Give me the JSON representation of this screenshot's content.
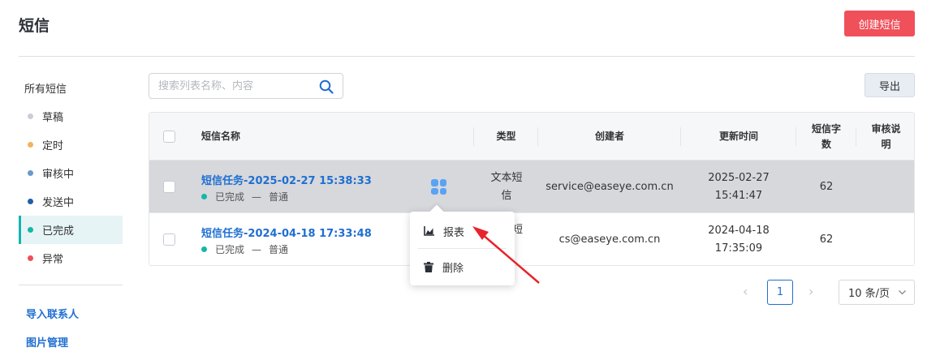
{
  "header": {
    "title": "短信",
    "create_label": "创建短信"
  },
  "sidebar": {
    "heading": "所有短信",
    "items": [
      {
        "label": "草稿",
        "color": "#c9ced6"
      },
      {
        "label": "定时",
        "color": "#f2b35b"
      },
      {
        "label": "审核中",
        "color": "#6a9ac7"
      },
      {
        "label": "发送中",
        "color": "#1e5fa8"
      },
      {
        "label": "已完成",
        "color": "#14b8a6"
      },
      {
        "label": "异常",
        "color": "#ef4d5a"
      }
    ],
    "active_index": 4,
    "links": [
      "导入联系人",
      "图片管理"
    ]
  },
  "search": {
    "placeholder": "搜索列表名称、内容"
  },
  "toolbar": {
    "export_label": "导出"
  },
  "table": {
    "columns": [
      "短信名称",
      "类型",
      "创建者",
      "更新时间",
      "短信字数",
      "审核说明"
    ],
    "rows": [
      {
        "name": "短信任务-2025-02-27 15:38:33",
        "status": "已完成",
        "dash": "—",
        "category": "普通",
        "type": "文本短信",
        "creator": "service@easeye.com.cn",
        "updated_date": "2025-02-27",
        "updated_time": "15:41:47",
        "chars": "62",
        "review": ""
      },
      {
        "name": "短信任务-2024-04-18 17:33:48",
        "status": "已完成",
        "dash": "—",
        "category": "普通",
        "type": "短",
        "creator": "cs@easeye.com.cn",
        "updated_date": "2024-04-18",
        "updated_time": "17:35:09",
        "chars": "62",
        "review": ""
      }
    ]
  },
  "popup_menu": {
    "items": [
      "报表",
      "删除"
    ]
  },
  "pagination": {
    "current": "1",
    "page_size": "10 条/页"
  }
}
